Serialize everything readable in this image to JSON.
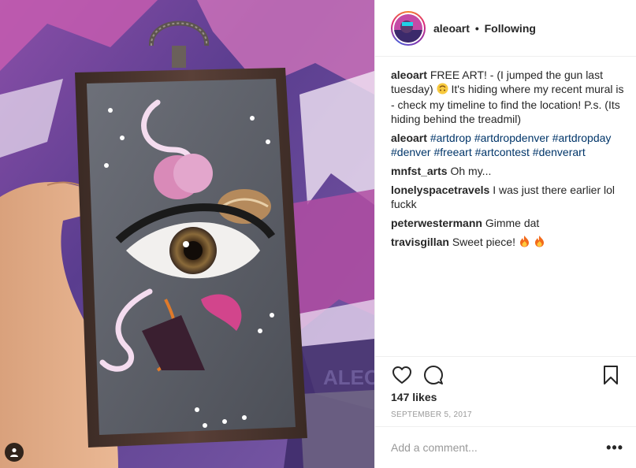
{
  "header": {
    "username": "aleoart",
    "separator": "•",
    "follow_status": "Following"
  },
  "photo": {
    "description_icon": "user-tag-icon",
    "background_colors": [
      "#7b4f9e",
      "#c25aa6",
      "#3b2a6b",
      "#e6d9f0"
    ]
  },
  "caption": {
    "username": "aleoart",
    "text_before_emoji": "FREE ART! - (I jumped the gun last tuesday)",
    "text_after_emoji": "It's hiding where my recent mural is - check my timeline to find the location! P.s. (Its hiding behind the treadmil)"
  },
  "hashtags_comment": {
    "username": "aleoart",
    "tags": [
      "#artdrop",
      "#artdropdenver",
      "#artdropday",
      "#denver",
      "#freeart",
      "#artcontest",
      "#denverart"
    ]
  },
  "comments": [
    {
      "username": "mnfst_arts",
      "text": "Oh my..."
    },
    {
      "username": "lonelyspacetravels",
      "text": "I was just there earlier lol fuckk"
    },
    {
      "username": "peterwestermann",
      "text": "Gimme dat"
    },
    {
      "username": "travisgillan",
      "text": "Sweet piece!"
    }
  ],
  "likes": "147 likes",
  "date": "SEPTEMBER 5, 2017",
  "add_comment": {
    "placeholder": "Add a comment...",
    "more": "•••"
  },
  "icons": {
    "like": "heart-icon",
    "comment": "comment-icon",
    "save": "bookmark-icon"
  },
  "colors": {
    "hashtag": "#003569",
    "muted": "#999999",
    "border": "#efefef"
  }
}
